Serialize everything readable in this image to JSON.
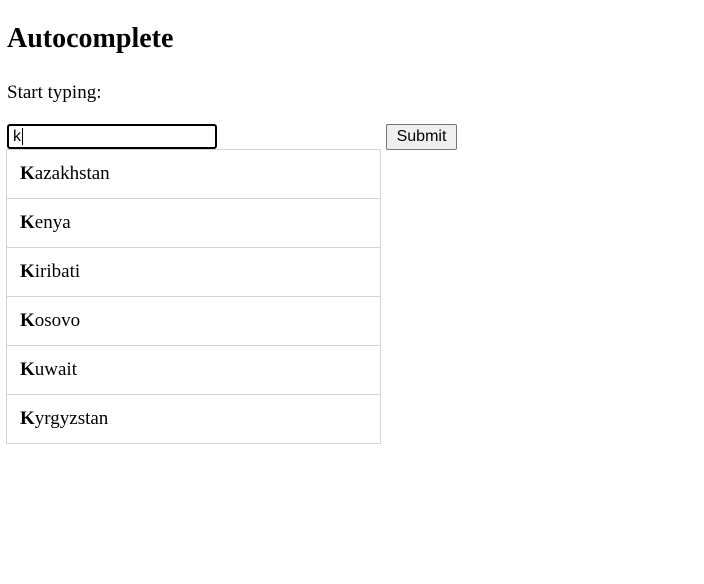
{
  "page": {
    "title": "Autocomplete",
    "prompt": "Start typing:"
  },
  "search": {
    "value": "k"
  },
  "submit": {
    "label": "Submit"
  },
  "suggestions": [
    {
      "match": "K",
      "rest": "azakhstan"
    },
    {
      "match": "K",
      "rest": "enya"
    },
    {
      "match": "K",
      "rest": "iribati"
    },
    {
      "match": "K",
      "rest": "osovo"
    },
    {
      "match": "K",
      "rest": "uwait"
    },
    {
      "match": "K",
      "rest": "yrgyzstan"
    }
  ]
}
